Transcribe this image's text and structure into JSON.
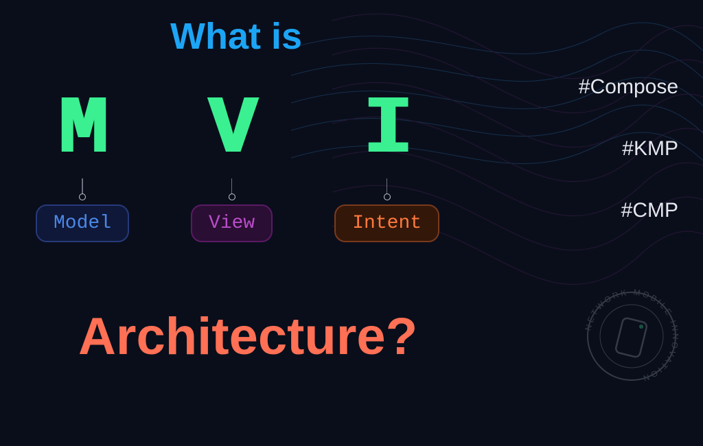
{
  "title_top": "What is",
  "title_bottom": "Architecture?",
  "letters": {
    "m": {
      "glyph": "M",
      "label": "Model"
    },
    "v": {
      "glyph": "V",
      "label": "View"
    },
    "i": {
      "glyph": "I",
      "label": "Intent"
    }
  },
  "hashtags": [
    "#Compose",
    "#KMP",
    "#CMP"
  ],
  "watermark_text": "NETWORK · MOBILE · INNOVATION",
  "colors": {
    "bg": "#0a0e1b",
    "accent_blue": "#1da5f5",
    "accent_green": "#3af091",
    "accent_coral": "#ff7055",
    "model": "#4a88e8",
    "view": "#b94dc9",
    "intent": "#ff7a3d"
  }
}
